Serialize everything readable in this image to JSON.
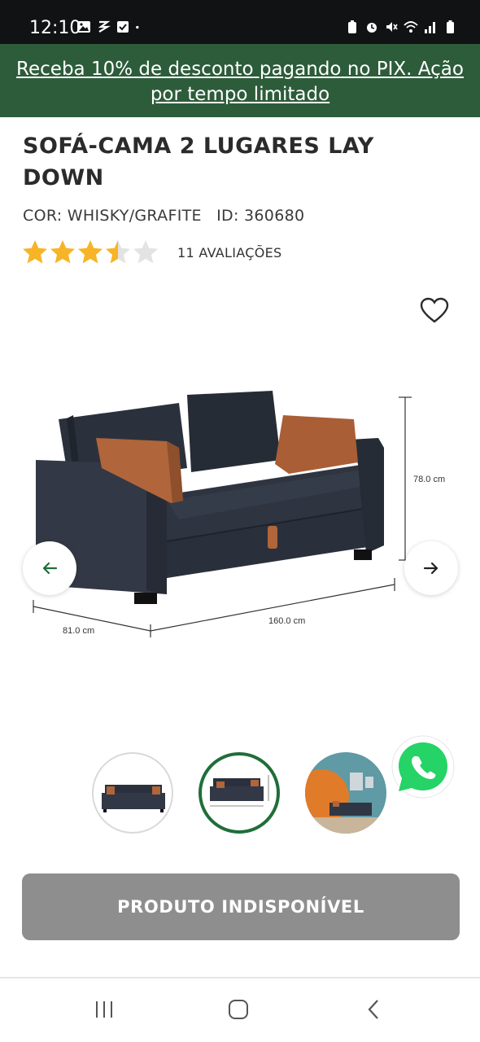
{
  "status_bar": {
    "time": "12:10",
    "left_icons": [
      "gallery-icon",
      "data-saver-icon",
      "task-check-icon",
      "dot-icon"
    ],
    "right_icons": [
      "battery-saver-icon",
      "alarm-icon",
      "mute-icon",
      "wifi-icon",
      "signal-icon",
      "battery-icon"
    ]
  },
  "promo": {
    "text": "Receba 10% de desconto pagando no PIX. Ação por tempo limitado"
  },
  "product": {
    "title": "SOFÁ-CAMA 2 LUGARES LAY DOWN",
    "color": "COR: WHISKY/GRAFITE",
    "id": "ID: 360680",
    "rating": 3.5,
    "rating_max": 5,
    "reviews": "11 AVALIAÇÕES"
  },
  "image": {
    "dimension_height": "78.0 cm",
    "dimension_width": "160.0 cm",
    "dimension_depth": "81.0 cm",
    "thumbnails_count": 3,
    "selected_thumbnail": 2
  },
  "actions": {
    "unavailable_label": "PRODUTO INDISPONÍVEL"
  },
  "colors": {
    "brand_green": "#2d5c3a",
    "selected_thumb_border": "#1f6e3a",
    "star": "#f6b426",
    "disabled_button": "#8e8e8e",
    "whatsapp": "#25d366"
  }
}
